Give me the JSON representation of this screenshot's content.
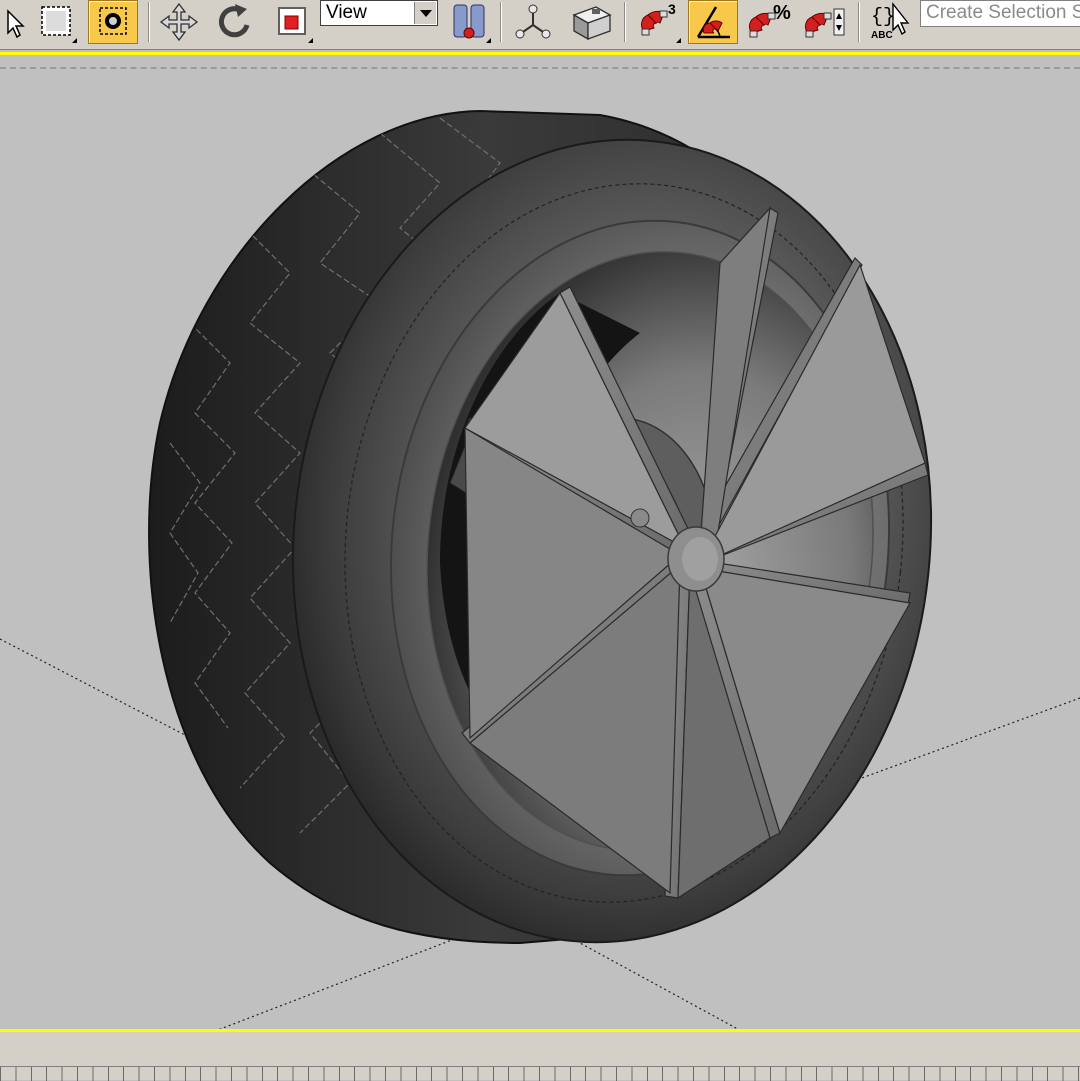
{
  "toolbar": {
    "ref_coord_system": "View",
    "angle_snap_label": "3",
    "percent_snap_label": "%",
    "named_selection_placeholder": "Create Selection Se",
    "edit_named_label": "ABC",
    "accent_active": "#f8c84a",
    "icons": [
      "select-object-icon",
      "rectangular-selection-region-icon",
      "window-crossing-icon",
      "select-and-move-icon",
      "select-and-rotate-icon",
      "select-and-scale-icon",
      "use-pivot-point-center-icon",
      "select-and-manipulate-icon",
      "keyboard-shortcut-override-icon",
      "snaps-toggle-icon",
      "angle-snap-toggle-icon",
      "percent-snap-toggle-icon",
      "spinner-snap-toggle-icon",
      "edit-named-selection-icon"
    ]
  },
  "viewport": {
    "active_border_color": "#ffff00",
    "background_color": "#c0c0c0",
    "content": "wheel-model"
  }
}
